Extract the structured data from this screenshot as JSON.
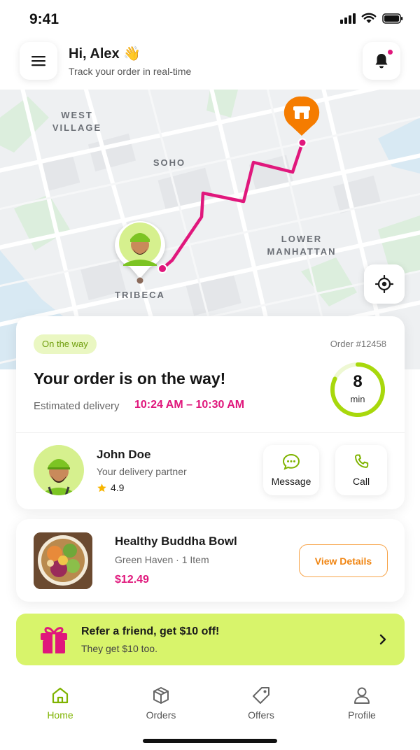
{
  "status_bar": {
    "time": "9:41"
  },
  "header": {
    "greeting": "Hi, Alex 👋",
    "subtitle": "Track your order in real-time"
  },
  "map": {
    "labels": {
      "west_village": "WEST\nVILLAGE",
      "soho": "SOHO",
      "lower_manhattan": "LOWER\nMANHATTAN",
      "tribeca": "TRIBECA"
    },
    "route_color": "#e0177c",
    "store_pin_color": "#f57c00"
  },
  "order": {
    "status": "On the way",
    "number": "Order #12458",
    "title": "Your order is on the way!",
    "eta_label": "Estimated delivery",
    "eta_time": "10:24 AM – 10:30 AM",
    "timer_value": "8",
    "timer_unit": "min",
    "timer_progress": 0.82
  },
  "driver": {
    "name": "John Doe",
    "role": "Your delivery partner",
    "rating": "4.9"
  },
  "actions": {
    "message_label": "Message",
    "call_label": "Call"
  },
  "food": {
    "name": "Healthy Buddha Bowl",
    "meta": "Green Haven · 1 Item",
    "price": "$12.49",
    "details_label": "View Details"
  },
  "promo": {
    "title": "Refer a friend, get $10 off!",
    "subtitle": "They get $10 too."
  },
  "nav": {
    "items": [
      {
        "label": "Home",
        "icon": "home-icon",
        "active": true
      },
      {
        "label": "Orders",
        "icon": "box-icon",
        "active": false
      },
      {
        "label": "Offers",
        "icon": "tag-icon",
        "active": false
      },
      {
        "label": "Profile",
        "icon": "user-icon",
        "active": false
      }
    ]
  },
  "colors": {
    "accent_pink": "#e0177c",
    "accent_green": "#a8d80c",
    "accent_orange": "#f08512"
  }
}
